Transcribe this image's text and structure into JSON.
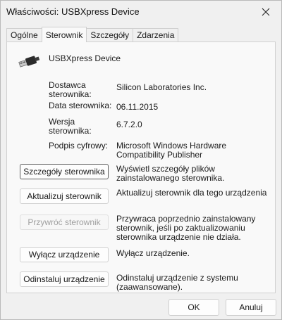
{
  "window": {
    "title": "Właściwości: USBXpress Device"
  },
  "tabs": [
    {
      "label": "Ogólne"
    },
    {
      "label": "Sterownik"
    },
    {
      "label": "Szczegóły"
    },
    {
      "label": "Zdarzenia"
    }
  ],
  "device": {
    "name": "USBXpress Device",
    "icon": "usb-connector-icon"
  },
  "driver_info": [
    {
      "label": "Dostawca\nsterownika:",
      "value": "Silicon Laboratories Inc."
    },
    {
      "label": "Data sterownika:",
      "value": "06.11.2015"
    },
    {
      "label": "Wersja\nsterownika:",
      "value": "6.7.2.0"
    },
    {
      "label": "Podpis cyfrowy:",
      "value": "Microsoft Windows Hardware Compatibility Publisher"
    }
  ],
  "actions": [
    {
      "label": "Szczegóły sterownika",
      "description": "Wyświetl szczegóły plików zainstalowanego sterownika.",
      "enabled": true
    },
    {
      "label": "Aktualizuj sterownik",
      "description": "Aktualizuj sterownik dla tego urządzenia",
      "enabled": true
    },
    {
      "label": "Przywróć sterownik",
      "description": "Przywraca poprzednio zainstalowany sterownik, jeśli po zaktualizowaniu sterownika urządzenie nie działa.",
      "enabled": false
    },
    {
      "label": "Wyłącz urządzenie",
      "description": "Wyłącz urządzenie.",
      "enabled": true
    },
    {
      "label": "Odinstaluj urządzenie",
      "description": "Odinstaluj urządzenie z systemu (zaawansowane).",
      "enabled": true
    }
  ],
  "footer": {
    "ok_label": "OK",
    "cancel_label": "Anuluj"
  },
  "colors": {
    "background": "#f0f0f0",
    "panel": "#f9f9f9",
    "disabled_text": "#a0a0a0"
  }
}
